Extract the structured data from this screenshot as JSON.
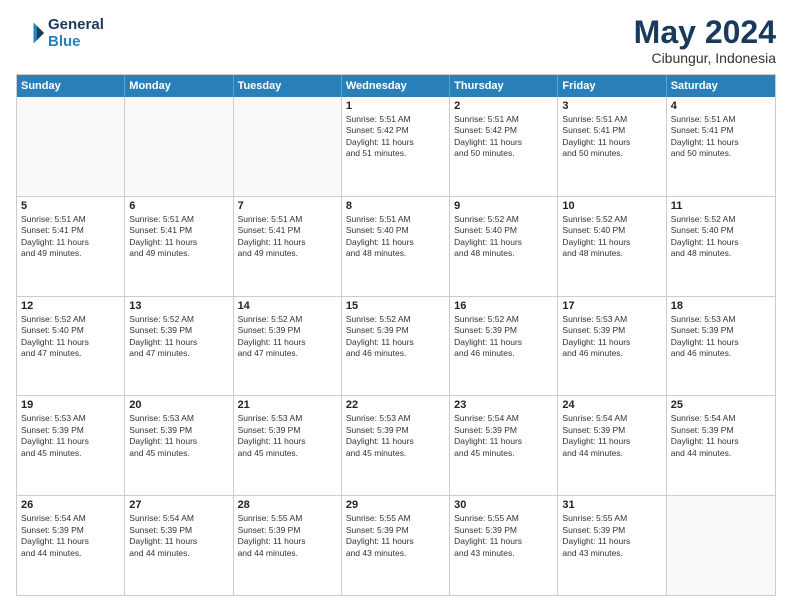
{
  "logo": {
    "text1": "General",
    "text2": "Blue"
  },
  "title": "May 2024",
  "location": "Cibungur, Indonesia",
  "days": [
    "Sunday",
    "Monday",
    "Tuesday",
    "Wednesday",
    "Thursday",
    "Friday",
    "Saturday"
  ],
  "weeks": [
    [
      {
        "day": "",
        "empty": true
      },
      {
        "day": "",
        "empty": true
      },
      {
        "day": "",
        "empty": true
      },
      {
        "day": "1",
        "lines": [
          "Sunrise: 5:51 AM",
          "Sunset: 5:42 PM",
          "Daylight: 11 hours",
          "and 51 minutes."
        ]
      },
      {
        "day": "2",
        "lines": [
          "Sunrise: 5:51 AM",
          "Sunset: 5:42 PM",
          "Daylight: 11 hours",
          "and 50 minutes."
        ]
      },
      {
        "day": "3",
        "lines": [
          "Sunrise: 5:51 AM",
          "Sunset: 5:41 PM",
          "Daylight: 11 hours",
          "and 50 minutes."
        ]
      },
      {
        "day": "4",
        "lines": [
          "Sunrise: 5:51 AM",
          "Sunset: 5:41 PM",
          "Daylight: 11 hours",
          "and 50 minutes."
        ]
      }
    ],
    [
      {
        "day": "5",
        "lines": [
          "Sunrise: 5:51 AM",
          "Sunset: 5:41 PM",
          "Daylight: 11 hours",
          "and 49 minutes."
        ]
      },
      {
        "day": "6",
        "lines": [
          "Sunrise: 5:51 AM",
          "Sunset: 5:41 PM",
          "Daylight: 11 hours",
          "and 49 minutes."
        ]
      },
      {
        "day": "7",
        "lines": [
          "Sunrise: 5:51 AM",
          "Sunset: 5:41 PM",
          "Daylight: 11 hours",
          "and 49 minutes."
        ]
      },
      {
        "day": "8",
        "lines": [
          "Sunrise: 5:51 AM",
          "Sunset: 5:40 PM",
          "Daylight: 11 hours",
          "and 48 minutes."
        ]
      },
      {
        "day": "9",
        "lines": [
          "Sunrise: 5:52 AM",
          "Sunset: 5:40 PM",
          "Daylight: 11 hours",
          "and 48 minutes."
        ]
      },
      {
        "day": "10",
        "lines": [
          "Sunrise: 5:52 AM",
          "Sunset: 5:40 PM",
          "Daylight: 11 hours",
          "and 48 minutes."
        ]
      },
      {
        "day": "11",
        "lines": [
          "Sunrise: 5:52 AM",
          "Sunset: 5:40 PM",
          "Daylight: 11 hours",
          "and 48 minutes."
        ]
      }
    ],
    [
      {
        "day": "12",
        "lines": [
          "Sunrise: 5:52 AM",
          "Sunset: 5:40 PM",
          "Daylight: 11 hours",
          "and 47 minutes."
        ]
      },
      {
        "day": "13",
        "lines": [
          "Sunrise: 5:52 AM",
          "Sunset: 5:39 PM",
          "Daylight: 11 hours",
          "and 47 minutes."
        ]
      },
      {
        "day": "14",
        "lines": [
          "Sunrise: 5:52 AM",
          "Sunset: 5:39 PM",
          "Daylight: 11 hours",
          "and 47 minutes."
        ]
      },
      {
        "day": "15",
        "lines": [
          "Sunrise: 5:52 AM",
          "Sunset: 5:39 PM",
          "Daylight: 11 hours",
          "and 46 minutes."
        ]
      },
      {
        "day": "16",
        "lines": [
          "Sunrise: 5:52 AM",
          "Sunset: 5:39 PM",
          "Daylight: 11 hours",
          "and 46 minutes."
        ]
      },
      {
        "day": "17",
        "lines": [
          "Sunrise: 5:53 AM",
          "Sunset: 5:39 PM",
          "Daylight: 11 hours",
          "and 46 minutes."
        ]
      },
      {
        "day": "18",
        "lines": [
          "Sunrise: 5:53 AM",
          "Sunset: 5:39 PM",
          "Daylight: 11 hours",
          "and 46 minutes."
        ]
      }
    ],
    [
      {
        "day": "19",
        "lines": [
          "Sunrise: 5:53 AM",
          "Sunset: 5:39 PM",
          "Daylight: 11 hours",
          "and 45 minutes."
        ]
      },
      {
        "day": "20",
        "lines": [
          "Sunrise: 5:53 AM",
          "Sunset: 5:39 PM",
          "Daylight: 11 hours",
          "and 45 minutes."
        ]
      },
      {
        "day": "21",
        "lines": [
          "Sunrise: 5:53 AM",
          "Sunset: 5:39 PM",
          "Daylight: 11 hours",
          "and 45 minutes."
        ]
      },
      {
        "day": "22",
        "lines": [
          "Sunrise: 5:53 AM",
          "Sunset: 5:39 PM",
          "Daylight: 11 hours",
          "and 45 minutes."
        ]
      },
      {
        "day": "23",
        "lines": [
          "Sunrise: 5:54 AM",
          "Sunset: 5:39 PM",
          "Daylight: 11 hours",
          "and 45 minutes."
        ]
      },
      {
        "day": "24",
        "lines": [
          "Sunrise: 5:54 AM",
          "Sunset: 5:39 PM",
          "Daylight: 11 hours",
          "and 44 minutes."
        ]
      },
      {
        "day": "25",
        "lines": [
          "Sunrise: 5:54 AM",
          "Sunset: 5:39 PM",
          "Daylight: 11 hours",
          "and 44 minutes."
        ]
      }
    ],
    [
      {
        "day": "26",
        "lines": [
          "Sunrise: 5:54 AM",
          "Sunset: 5:39 PM",
          "Daylight: 11 hours",
          "and 44 minutes."
        ]
      },
      {
        "day": "27",
        "lines": [
          "Sunrise: 5:54 AM",
          "Sunset: 5:39 PM",
          "Daylight: 11 hours",
          "and 44 minutes."
        ]
      },
      {
        "day": "28",
        "lines": [
          "Sunrise: 5:55 AM",
          "Sunset: 5:39 PM",
          "Daylight: 11 hours",
          "and 44 minutes."
        ]
      },
      {
        "day": "29",
        "lines": [
          "Sunrise: 5:55 AM",
          "Sunset: 5:39 PM",
          "Daylight: 11 hours",
          "and 43 minutes."
        ]
      },
      {
        "day": "30",
        "lines": [
          "Sunrise: 5:55 AM",
          "Sunset: 5:39 PM",
          "Daylight: 11 hours",
          "and 43 minutes."
        ]
      },
      {
        "day": "31",
        "lines": [
          "Sunrise: 5:55 AM",
          "Sunset: 5:39 PM",
          "Daylight: 11 hours",
          "and 43 minutes."
        ]
      },
      {
        "day": "",
        "empty": true
      }
    ]
  ]
}
